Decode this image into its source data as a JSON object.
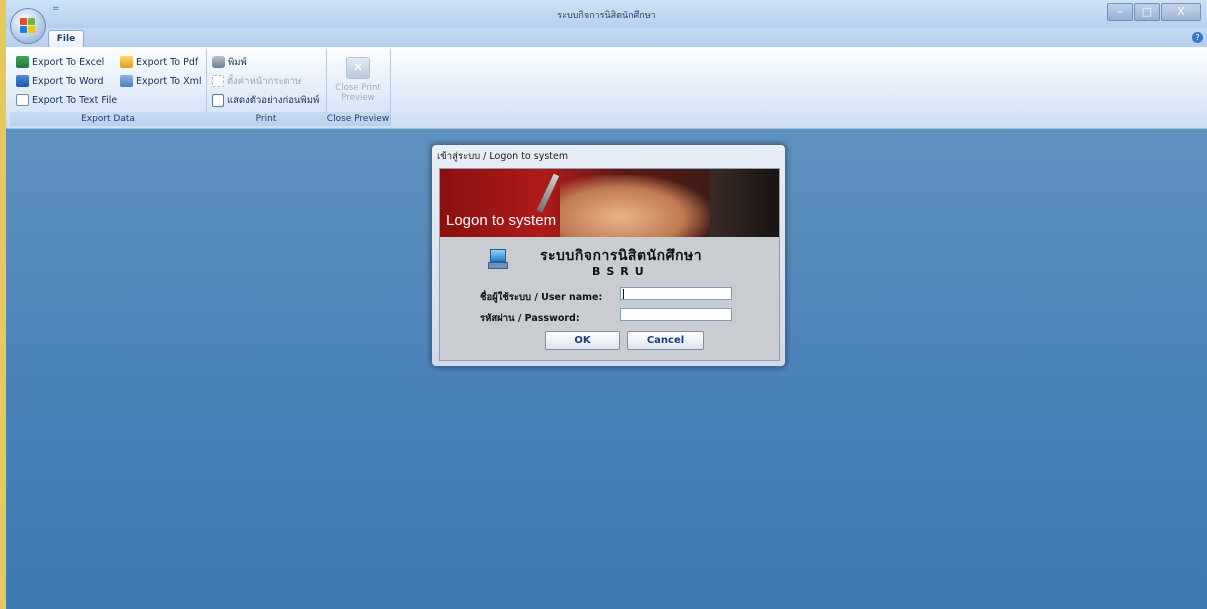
{
  "window": {
    "title": "ระบบกิจการนิสิตนักศึกษา",
    "quick_access": "=",
    "minimize": "–",
    "maximize": "□",
    "close": "X"
  },
  "tabs": {
    "file": "File",
    "help": "?"
  },
  "ribbon": {
    "export_group": {
      "label": "Export Data",
      "export_excel": "Export To Excel",
      "export_word": "Export To Word",
      "export_text": "Export To Text File",
      "export_pdf": "Export To Pdf",
      "export_xml": "Export To Xml"
    },
    "print_group": {
      "label": "Print",
      "print": "พิมพ์",
      "page_setup": "ตั้งค่าหน้ากระดาษ",
      "print_preview": "แสดงตัวอย่างก่อนพิมพ์"
    },
    "close_group": {
      "label": "Close Preview",
      "close_print_preview": "Close Print Preview",
      "close_icon_glyph": "✕"
    }
  },
  "dialog": {
    "title": "เข้าสู่ระบบ / Logon to system",
    "banner_text": "Logon to system",
    "app_name": "ระบบกิจการนิสิตนักศึกษา",
    "app_abbr": "BSRU",
    "username_label": "ชื่อผู้ใช้ระบบ / User name:",
    "username_value": "",
    "password_label": "รหัสผ่าน / Password:",
    "password_value": "",
    "ok_label": "OK",
    "cancel_label": "Cancel"
  },
  "colors": {
    "workspace": "#4a82b8",
    "banner_red": "#b01a1a",
    "button_text": "#1a3f7a"
  }
}
